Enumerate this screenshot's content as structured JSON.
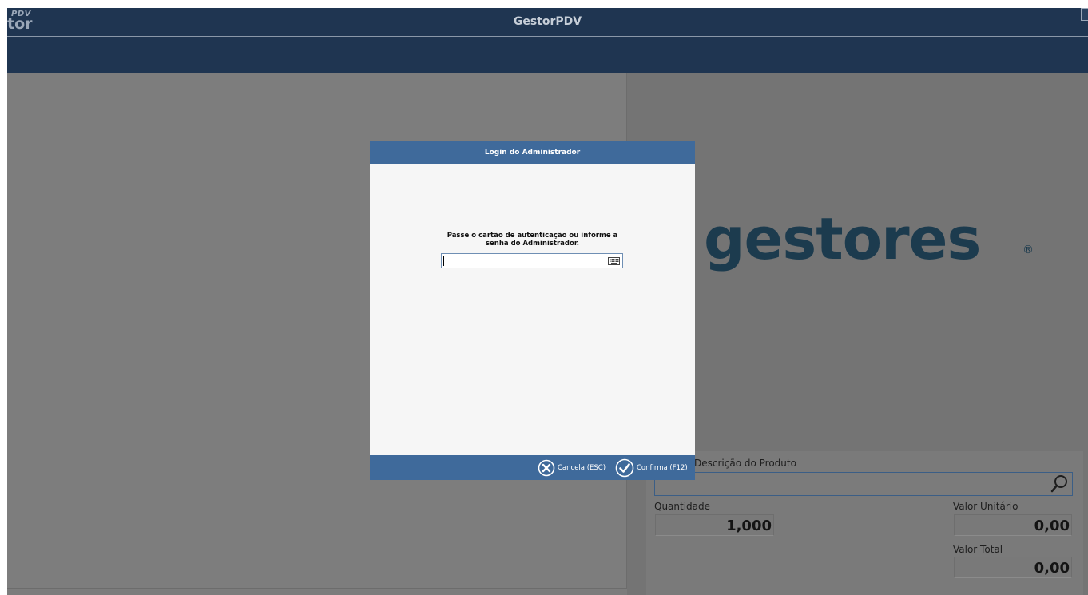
{
  "window": {
    "logo_top": "PDV",
    "logo_bottom": "tor",
    "title": "GestorPDV"
  },
  "brand": {
    "text": "gestores",
    "registered": "®"
  },
  "product_panel": {
    "description_label": "Descrição do Produto",
    "description_value": "",
    "quantity_label": "Quantidade",
    "quantity_value": "1,000",
    "unit_price_label": "Valor Unitário",
    "unit_price_value": "0,00",
    "total_label": "Valor Total",
    "total_value": "0,00"
  },
  "dialog": {
    "title": "Login do Administrador",
    "message_line1": "Passe o cartão de autenticação ou informe a",
    "message_line2": "senha do Administrador.",
    "password_value": "",
    "cancel_label": "Cancela (ESC)",
    "confirm_label": "Confirma (F12)"
  },
  "colors": {
    "titlebar": "#1f3551",
    "dialog_header": "#3f6a9b",
    "brand": "#1c3b4e"
  },
  "icons": {
    "search": "magnifier-icon",
    "keyboard": "keyboard-icon",
    "cancel": "cancel-circle-icon",
    "confirm": "check-circle-icon"
  }
}
